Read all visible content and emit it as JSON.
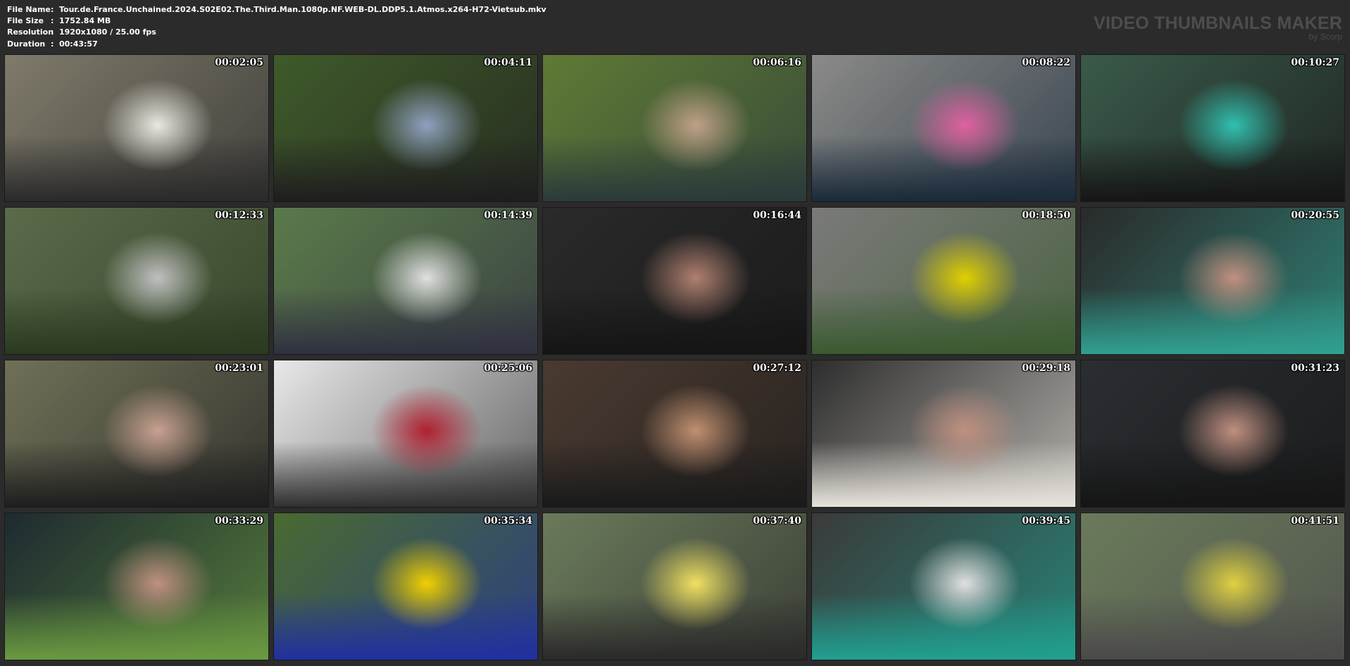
{
  "header": {
    "file_name_label": "File Name",
    "file_name_value": "Tour.de.France.Unchained.2024.S02E02.The.Third.Man.1080p.NF.WEB-DL.DDP5.1.Atmos.x264-H72-Vietsub.mkv",
    "file_size_label": "File Size",
    "file_size_value": "1752.84 MB",
    "resolution_label": "Resolution",
    "resolution_value": "1920x1080 / 25.00 fps",
    "duration_label": "Duration",
    "duration_value": "00:43:57",
    "separator": ":"
  },
  "brand": {
    "title": "VIDEO THUMBNAILS MAKER",
    "subtitle": "by Scorp"
  },
  "thumbnails": [
    {
      "time": "00:02:05",
      "bg": "#7f7a6a",
      "accent": "#e8e8e0",
      "dark": "#2a2a2a"
    },
    {
      "time": "00:04:11",
      "bg": "#3f5a2a",
      "accent": "#8fa0c0",
      "dark": "#1e1e1e"
    },
    {
      "time": "00:06:16",
      "bg": "#5f7a35",
      "accent": "#c0a088",
      "dark": "#2a3a3a"
    },
    {
      "time": "00:08:22",
      "bg": "#8a8a88",
      "accent": "#e060a0",
      "dark": "#1a2a3a"
    },
    {
      "time": "00:10:27",
      "bg": "#3a5a4a",
      "accent": "#30c0b0",
      "dark": "#151515"
    },
    {
      "time": "00:12:33",
      "bg": "#5a6a4a",
      "accent": "#c0c0c0",
      "dark": "#2a3a20"
    },
    {
      "time": "00:14:39",
      "bg": "#5a7a4a",
      "accent": "#e0e0e0",
      "dark": "#303040"
    },
    {
      "time": "00:16:44",
      "bg": "#2a2a2a",
      "accent": "#b08070",
      "dark": "#151515"
    },
    {
      "time": "00:18:50",
      "bg": "#7a7a78",
      "accent": "#e0d000",
      "dark": "#3a5a30"
    },
    {
      "time": "00:20:55",
      "bg": "#2a2a2a",
      "accent": "#c09080",
      "dark": "#30a090"
    },
    {
      "time": "00:23:01",
      "bg": "#707058",
      "accent": "#c8a090",
      "dark": "#1e1e1e"
    },
    {
      "time": "00:25:06",
      "bg": "#e8e8e8",
      "accent": "#b02030",
      "dark": "#303030"
    },
    {
      "time": "00:27:12",
      "bg": "#4a3a30",
      "accent": "#c09070",
      "dark": "#1a1a1a"
    },
    {
      "time": "00:29:18",
      "bg": "#2e2e2e",
      "accent": "#c09080",
      "dark": "#e8e4dc"
    },
    {
      "time": "00:31:23",
      "bg": "#2a2e32",
      "accent": "#c09080",
      "dark": "#151515"
    },
    {
      "time": "00:33:29",
      "bg": "#1e2a30",
      "accent": "#c09080",
      "dark": "#6a9a40"
    },
    {
      "time": "00:35:34",
      "bg": "#4a6a30",
      "accent": "#f0d000",
      "dark": "#2030a0"
    },
    {
      "time": "00:37:40",
      "bg": "#6a7a5a",
      "accent": "#f0e060",
      "dark": "#2a2a2a"
    },
    {
      "time": "00:39:45",
      "bg": "#3a3a3a",
      "accent": "#e0e0e0",
      "dark": "#20a090"
    },
    {
      "time": "00:41:51",
      "bg": "#6a7a5a",
      "accent": "#e0d040",
      "dark": "#4a4a4a"
    }
  ]
}
